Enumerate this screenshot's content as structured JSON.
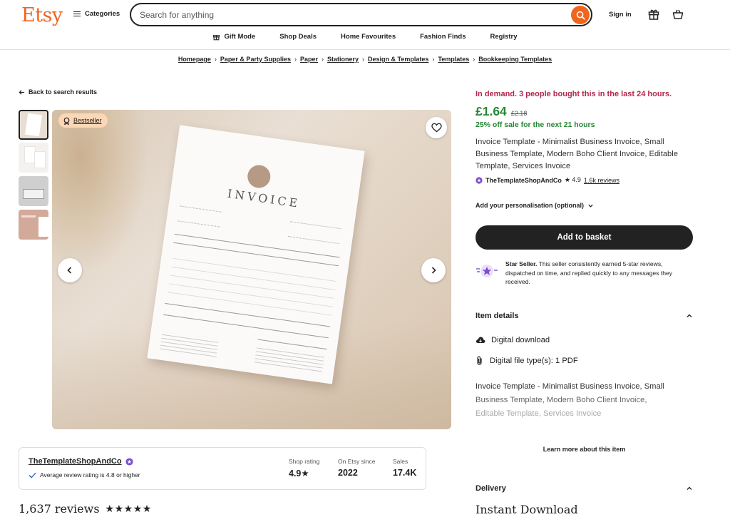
{
  "header": {
    "logo": "Etsy",
    "categories_label": "Categories",
    "search_placeholder": "Search for anything",
    "signin_label": "Sign in",
    "subnav": [
      "Gift Mode",
      "Shop Deals",
      "Home Favourites",
      "Fashion Finds",
      "Registry"
    ]
  },
  "breadcrumb": [
    "Homepage",
    "Paper & Party Supplies",
    "Paper",
    "Stationery",
    "Design & Templates",
    "Templates",
    "Bookkeeping Templates"
  ],
  "back_label": "Back to search results",
  "gallery": {
    "badge": "Bestseller",
    "invoice_title": "INVOICE"
  },
  "shop_card": {
    "name": "TheTemplateShopAndCo",
    "avg_text": "Average review rating is 4.8 or higher",
    "stats": [
      {
        "label": "Shop rating",
        "value": "4.9★"
      },
      {
        "label": "On Etsy since",
        "value": "2022"
      },
      {
        "label": "Sales",
        "value": "17.4K"
      }
    ]
  },
  "reviews": {
    "count": "1,637 reviews",
    "stars": "★★★★★"
  },
  "product": {
    "demand": "In demand. 3 people bought this in the last 24 hours.",
    "price": "£1.64",
    "old_price": "£2.18",
    "sale": "25% off sale for the next 21 hours",
    "title": "Invoice Template - Minimalist Business Invoice, Small Business Template, Modern Boho Client Invoice, Editable Template, Services Invoice",
    "seller": "TheTemplateShopAndCo",
    "rating": "★ 4.9",
    "reviews_link": "1.6k reviews",
    "personalisation": "Add your personalisation (optional)",
    "add_to_basket": "Add to basket",
    "star_seller_bold": "Star Seller.",
    "star_seller_text": " This seller consistently earned 5-star reviews, dispatched on time, and replied quickly to any messages they received."
  },
  "item_details": {
    "heading": "Item details",
    "download": "Digital download",
    "file_types": "Digital file type(s): 1 PDF",
    "desc_1": "Invoice Template - Minimalist Business Invoice, Small",
    "desc_2": "Business Template, Modern Boho Client Invoice,",
    "desc_3": "Editable Template, Services Invoice",
    "learn_more": "Learn more about this item"
  },
  "delivery": {
    "heading": "Delivery",
    "instant": "Instant Download"
  },
  "colors": {
    "brand": "#f1641e",
    "demand": "#b1264d",
    "sale": "#258635",
    "star_seller": "#7b4fd0"
  }
}
